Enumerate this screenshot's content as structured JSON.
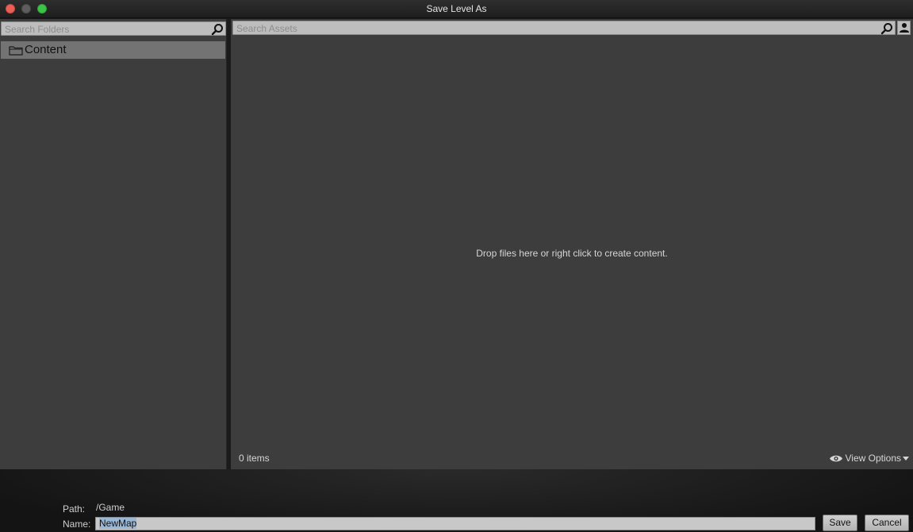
{
  "window": {
    "title": "Save Level As"
  },
  "folders": {
    "search_placeholder": "Search Folders",
    "tree": [
      {
        "label": "Content",
        "icon": "folder-icon",
        "selected": true
      }
    ]
  },
  "assets": {
    "search_placeholder": "Search Assets",
    "empty_message": "Drop files here or right click to create content.",
    "item_count": "0 items",
    "view_options_label": "View Options"
  },
  "footer": {
    "path_label": "Path:",
    "path_value": "/Game",
    "name_label": "Name:",
    "name_value": "NewMap",
    "save_label": "Save",
    "cancel_label": "Cancel"
  },
  "colors": {
    "panel_bg": "#3d3d3d",
    "selection": "#737373",
    "close": "#ec5f57",
    "maximize": "#3dc347"
  }
}
